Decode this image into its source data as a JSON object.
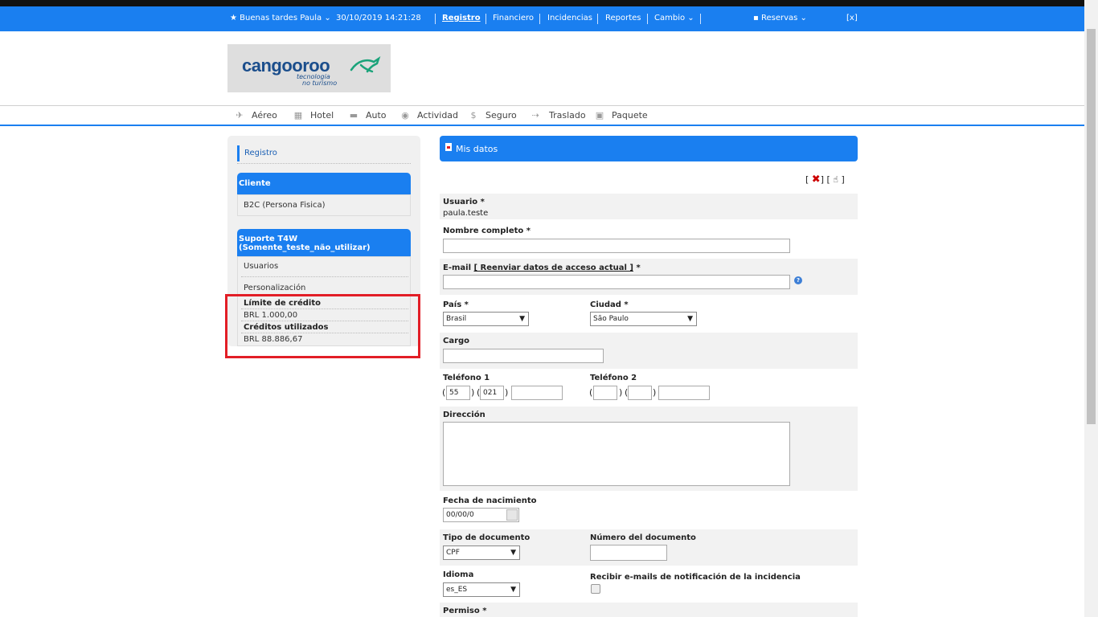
{
  "topbar": {
    "greeting": "★ Buenas tardes Paula ⌄",
    "datetime": "30/10/2019 14:21:28",
    "registro": "Registro",
    "financiero": "Financiero",
    "incidencias": "Incidencias",
    "reportes": "Reportes",
    "cambio": "Cambio ⌄",
    "reservas": "Reservas ⌄",
    "close": "[x]"
  },
  "logo": {
    "word": "cangooroo",
    "tagline1": "tecnologia",
    "tagline2": "no turismo"
  },
  "nav": [
    {
      "label": "Aéreo",
      "icon": "plane-icon",
      "glyph": "✈"
    },
    {
      "label": "Hotel",
      "icon": "hotel-icon",
      "glyph": "▦"
    },
    {
      "label": "Auto",
      "icon": "car-icon",
      "glyph": "▬"
    },
    {
      "label": "Actividad",
      "icon": "camera-icon",
      "glyph": "◉"
    },
    {
      "label": "Seguro",
      "icon": "dollar-icon",
      "glyph": "$"
    },
    {
      "label": "Traslado",
      "icon": "transfer-icon",
      "glyph": "⇢"
    },
    {
      "label": "Paquete",
      "icon": "briefcase-icon",
      "glyph": "▣"
    }
  ],
  "sidebar": {
    "registro": "Registro",
    "cliente_title": "Cliente",
    "cliente_value": "B2C (Persona Fisica)",
    "soporte_title1": "Suporte T4W",
    "soporte_title2": "(Somente_teste_não_utilizar)",
    "usuarios": "Usuarios",
    "personalizacion": "Personalización",
    "limite_label": "Límite de crédito",
    "limite_value": "BRL 1.000,00",
    "creditos_label": "Créditos utilizados",
    "creditos_value": "BRL 88.886,67"
  },
  "form": {
    "title": "Mis datos",
    "tools_open": "[",
    "tools_mid": "] [",
    "tools_close": "]",
    "close_glyph": "✖",
    "hand_glyph": "☝",
    "usuario_label": "Usuario *",
    "usuario_value": "paula.teste",
    "nombre_label": "Nombre completo *",
    "nombre_value": "",
    "email_label": "E-mail",
    "email_link": "[ Reenviar datos de acceso actual ]",
    "email_req": "*",
    "email_value": "",
    "help_glyph": "?",
    "pais_label": "País *",
    "pais_value": "Brasil",
    "ciudad_label": "Ciudad *",
    "ciudad_value": "São Paulo",
    "cargo_label": "Cargo",
    "cargo_value": "",
    "tel1_label": "Teléfono 1",
    "tel1_country": "55",
    "tel1_area": "021",
    "tel1_number": "",
    "tel2_label": "Teléfono 2",
    "tel2_country": "",
    "tel2_area": "",
    "tel2_number": "",
    "paren_open": "(",
    "paren_close": ")",
    "direccion_label": "Dirección",
    "direccion_value": "",
    "fecha_label": "Fecha de nacimiento",
    "fecha_value": "00/00/0",
    "tipodoc_label": "Tipo de documento",
    "tipodoc_value": "CPF",
    "numdoc_label": "Número del documento",
    "numdoc_value": "",
    "idioma_label": "Idioma",
    "idioma_value": "es_ES",
    "recibir_label": "Recibir e-mails de notificación de la incidencia",
    "permiso_label": "Permiso *",
    "arrow": "▼"
  }
}
